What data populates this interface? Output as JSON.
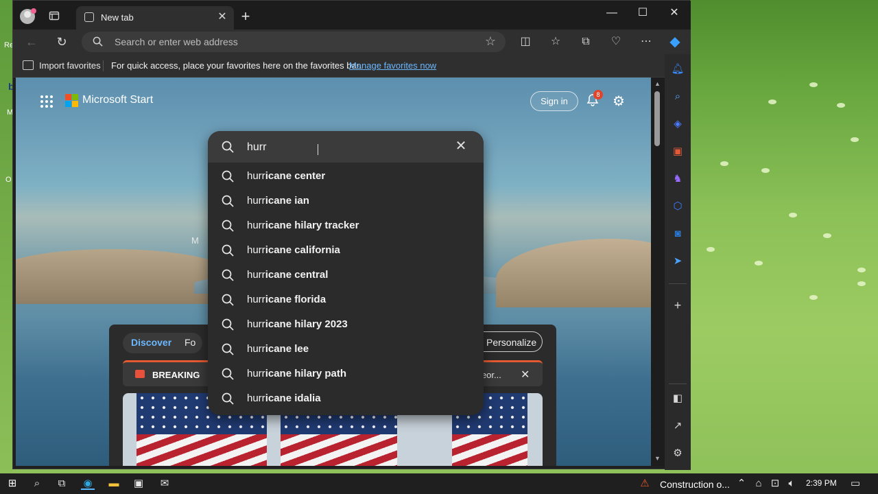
{
  "browser": {
    "tab_title": "New tab",
    "address_placeholder": "Search or enter web address",
    "favorites_import": "Import favorites",
    "favorites_message": "For quick access, place your favorites here on the favorites bar.",
    "favorites_manage_link": "Manage favorites now"
  },
  "page": {
    "brand": "Microsoft Start",
    "sign_in": "Sign in",
    "notification_count": "8",
    "partial_letter": "M"
  },
  "search": {
    "query": "hurr",
    "suggestions": [
      {
        "prefix": "hurr",
        "completion": "icane center"
      },
      {
        "prefix": "hurr",
        "completion": "icane ian"
      },
      {
        "prefix": "hurr",
        "completion": "icane hilary tracker"
      },
      {
        "prefix": "hurr",
        "completion": "icane california"
      },
      {
        "prefix": "hurr",
        "completion": "icane central"
      },
      {
        "prefix": "hurr",
        "completion": "icane florida"
      },
      {
        "prefix": "hurr",
        "completion": "icane hilary 2023"
      },
      {
        "prefix": "hurr",
        "completion": "icane lee"
      },
      {
        "prefix": "hurr",
        "completion": "icane hilary path"
      },
      {
        "prefix": "hurr",
        "completion": "icane idalia"
      }
    ]
  },
  "feed": {
    "tab_discover": "Discover",
    "tab_partial": "Fo",
    "personalize": "Personalize",
    "breaking_label": "BREAKING",
    "breaking_tail": "o Geor..."
  },
  "taskbar": {
    "tray_label": "Construction o...",
    "clock": "2:39 PM"
  },
  "desktop": {
    "partial_labels": [
      "Re",
      "b",
      "M",
      "O"
    ]
  },
  "colors": {
    "link": "#6cb8ff",
    "badge": "#e0452b",
    "breaking_accent": "#e55a30"
  }
}
